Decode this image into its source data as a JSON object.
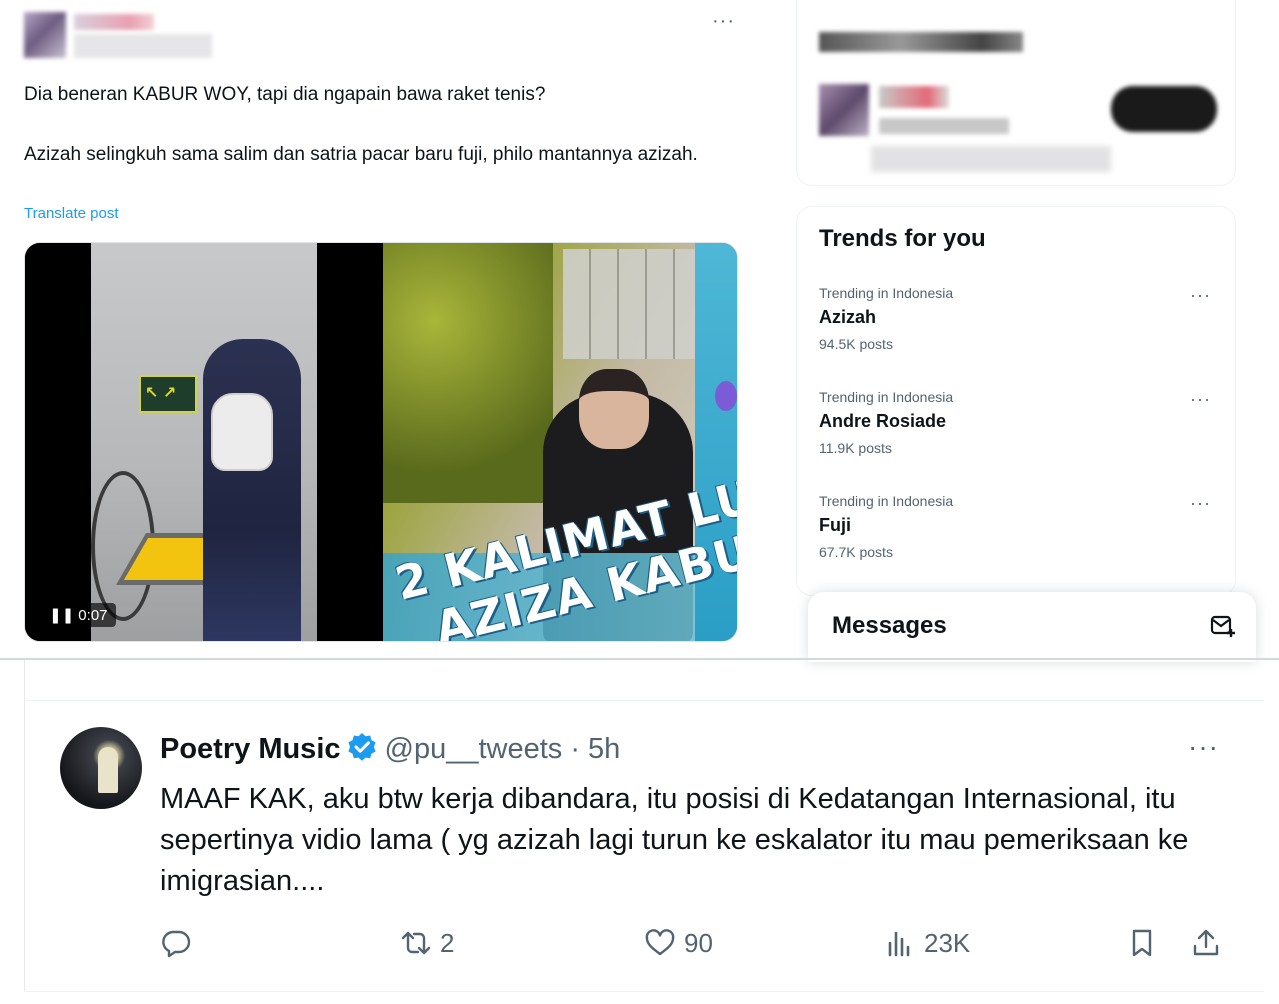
{
  "top_post": {
    "more_label": "···",
    "text_line1": "Dia beneran KABUR WOY, tapi dia ngapain bawa raket tenis?",
    "text_line2": "Azizah selingkuh sama salim dan satria pacar baru fuji,  philo mantannya azizah.",
    "translate_label": "Translate post",
    "video_time": "❚❚ 0:07",
    "overlay_line1": "2 KALIMAT LU",
    "overlay_line2": "AZIZA KABU"
  },
  "trends": {
    "title": "Trends for you",
    "items": [
      {
        "context": "Trending in Indonesia",
        "name": "Azizah",
        "posts": "94.5K posts"
      },
      {
        "context": "Trending in Indonesia",
        "name": "Andre Rosiade",
        "posts": "11.9K posts"
      },
      {
        "context": "Trending in Indonesia",
        "name": "Fuji",
        "posts": "67.7K posts"
      }
    ],
    "more_label": "···"
  },
  "messages": {
    "title": "Messages"
  },
  "tweet": {
    "name": "Poetry Music",
    "handle": "@pu__tweets · 5h",
    "more_label": "···",
    "text": "MAAF KAK, aku btw kerja dibandara, itu posisi di Kedatangan Internasional, itu sepertinya vidio lama ( yg azizah lagi turun ke eskalator itu mau pemeriksaan ke imigrasian....",
    "actions": {
      "reply_count": "",
      "retweet_count": "2",
      "like_count": "90",
      "views_count": "23K"
    }
  },
  "colors": {
    "link": "#1d9bf0",
    "verified": "#1d9bf0",
    "secondary_text": "#536471",
    "primary_text": "#0f1419"
  },
  "icons": [
    "more-icon",
    "verified-icon",
    "reply-icon",
    "retweet-icon",
    "like-icon",
    "views-icon",
    "bookmark-icon",
    "share-icon",
    "new-message-icon",
    "pause-icon"
  ]
}
